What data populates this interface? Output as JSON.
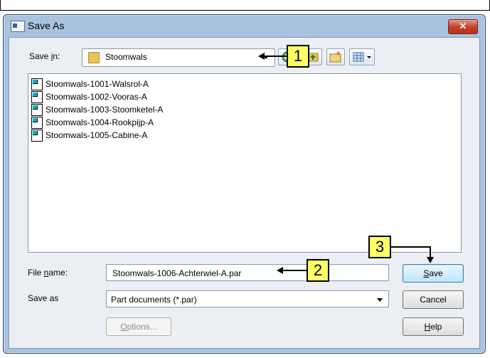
{
  "window": {
    "title": "Save As",
    "close_glyph": "✕"
  },
  "save_in": {
    "label_pre": "Save ",
    "label_key": "i",
    "label_post": "n:",
    "folder": "Stoomwals"
  },
  "files": [
    "Stoomwals-1001-Walsrol-A",
    "Stoomwals-1002-Vooras-A",
    "Stoomwals-1003-Stoomketel-A",
    "Stoomwals-1004-Rookpijp-A",
    "Stoomwals-1005-Cabine-A"
  ],
  "file_name": {
    "label_pre": "File ",
    "label_key": "n",
    "label_post": "ame:",
    "value": "Stoomwals-1006-Achterwiel-A.par"
  },
  "save_as": {
    "label": "Save as",
    "value": "Part documents (*.par)"
  },
  "buttons": {
    "save_key": "S",
    "save_rest": "ave",
    "cancel": "Cancel",
    "options_key": "O",
    "options_rest": "ptions...",
    "help_key": "H",
    "help_rest": "elp"
  },
  "callouts": [
    "1",
    "2",
    "3"
  ],
  "icons": [
    "folder-icon",
    "back-icon",
    "up-folder-icon",
    "new-folder-icon",
    "view-menu-icon",
    "part-document-icon"
  ],
  "colors": {
    "callout_fill": "#ffff66",
    "title_bar": "#a9c3df",
    "close_button": "#c7432a"
  }
}
